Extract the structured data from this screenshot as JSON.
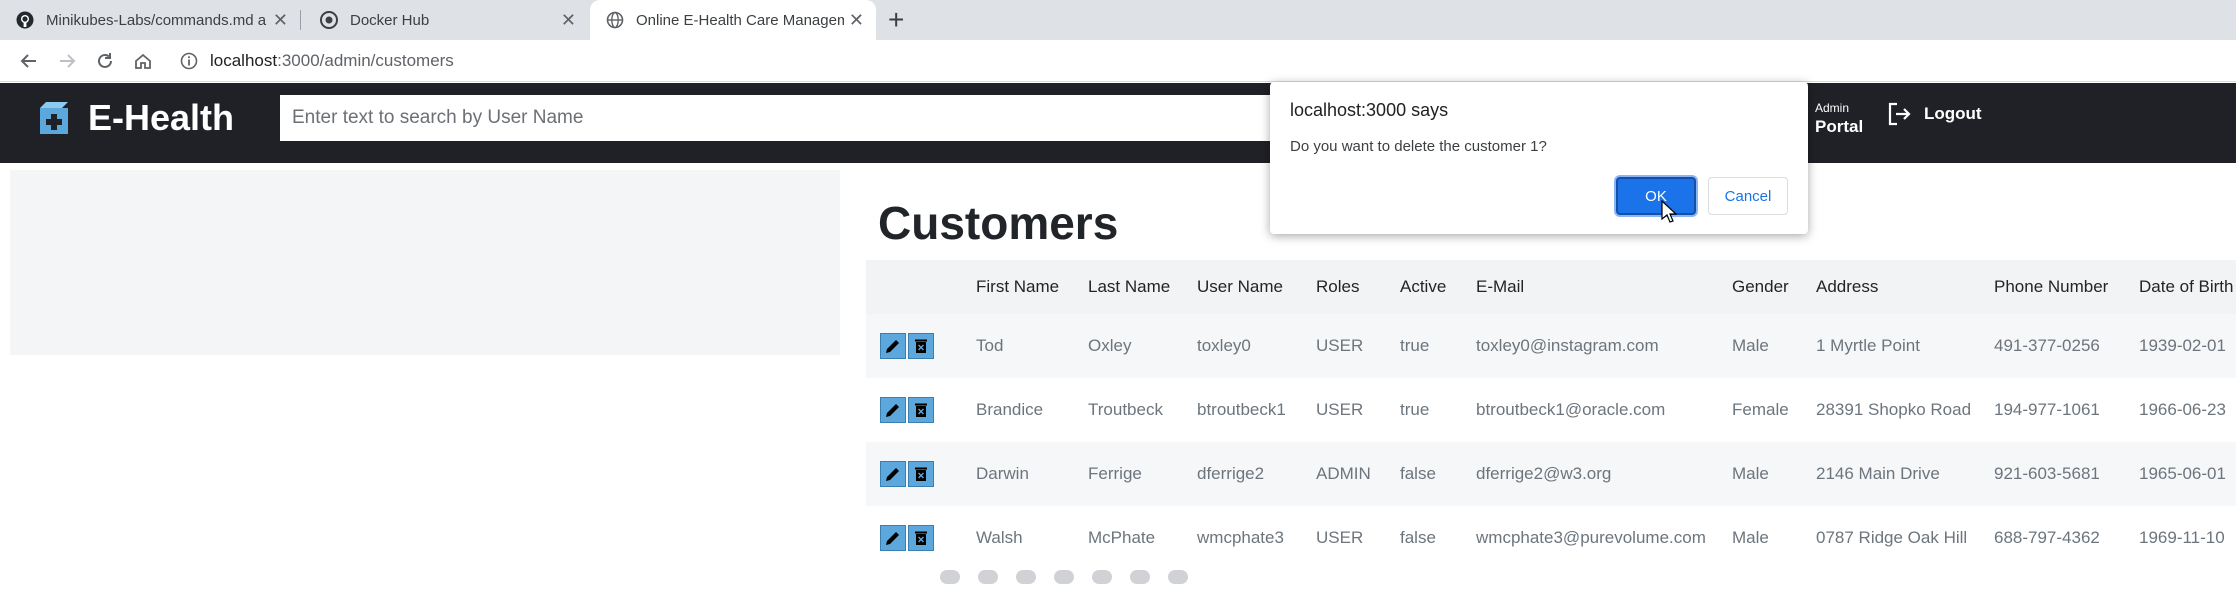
{
  "browser": {
    "tabs": [
      {
        "label": "Minikubes-Labs/commands.md a",
        "icon": "github-icon"
      },
      {
        "label": "Docker Hub",
        "icon": "docker-icon"
      },
      {
        "label": "Online E-Health Care Manageme",
        "icon": "globe-icon",
        "active": true
      }
    ],
    "new_tab_label": "+",
    "close_glyph": "✕",
    "url_host": "localhost",
    "url_path": ":3000/admin/customers"
  },
  "header": {
    "brand": "E-Health",
    "search_placeholder": "Enter text to search by User Name",
    "portal_small": "Admin",
    "portal_big": "Portal",
    "logout_label": "Logout"
  },
  "page": {
    "title": "Customers",
    "columns": [
      "First Name",
      "Last Name",
      "User Name",
      "Roles",
      "Active",
      "E-Mail",
      "Gender",
      "Address",
      "Phone Number",
      "Date of Birth"
    ],
    "rows": [
      [
        "Tod",
        "Oxley",
        "toxley0",
        "USER",
        "true",
        "toxley0@instagram.com",
        "Male",
        "1 Myrtle Point",
        "491-377-0256",
        "1939-02-01"
      ],
      [
        "Brandice",
        "Troutbeck",
        "btroutbeck1",
        "USER",
        "true",
        "btroutbeck1@oracle.com",
        "Female",
        "28391 Shopko Road",
        "194-977-1061",
        "1966-06-23"
      ],
      [
        "Darwin",
        "Ferrige",
        "dferrige2",
        "ADMIN",
        "false",
        "dferrige2@w3.org",
        "Male",
        "2146 Main Drive",
        "921-603-5681",
        "1965-06-01"
      ],
      [
        "Walsh",
        "McPhate",
        "wmcphate3",
        "USER",
        "false",
        "wmcphate3@purevolume.com",
        "Male",
        "0787 Ridge Oak Hill",
        "688-797-4362",
        "1969-11-10"
      ]
    ]
  },
  "dialog": {
    "title": "localhost:3000 says",
    "message": "Do you want to delete the customer 1?",
    "ok_label": "OK",
    "cancel_label": "Cancel"
  },
  "colors": {
    "header_bg": "#1f2126",
    "action_button": "#5ca8dc",
    "dialog_primary": "#1a73e8"
  }
}
